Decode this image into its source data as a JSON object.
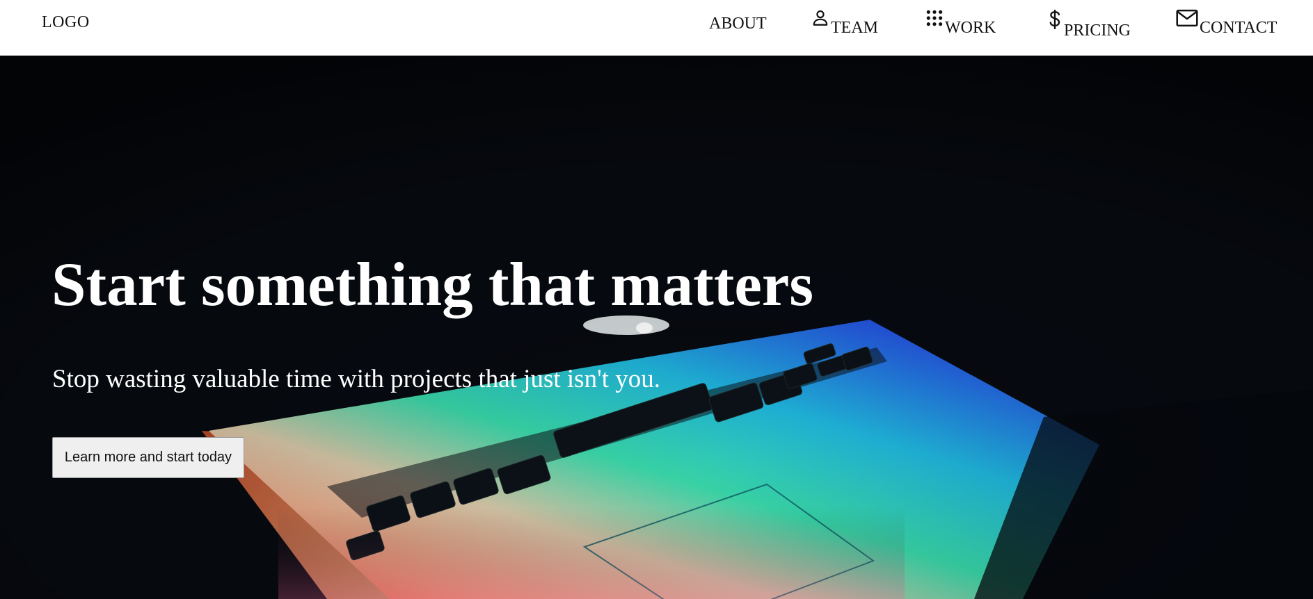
{
  "nav": {
    "logo": "LOGO",
    "items": [
      {
        "label": "ABOUT",
        "icon": "none"
      },
      {
        "label": "TEAM",
        "icon": "person-icon"
      },
      {
        "label": "WORK",
        "icon": "grid-icon"
      },
      {
        "label": "PRICING",
        "icon": "dollar-icon"
      },
      {
        "label": "CONTACT",
        "icon": "mail-icon"
      }
    ]
  },
  "hero": {
    "title": "Start something that matters",
    "subtitle": "Stop wasting valuable time with projects that just isn't you.",
    "cta_label": "Learn more and start today",
    "background_image": "laptop-keyboard-glow-photo"
  },
  "colors": {
    "nav_background": "#ffffff",
    "nav_text": "#111111",
    "hero_background": "#070a10",
    "hero_text": "#ffffff",
    "button_background": "#efefef"
  }
}
